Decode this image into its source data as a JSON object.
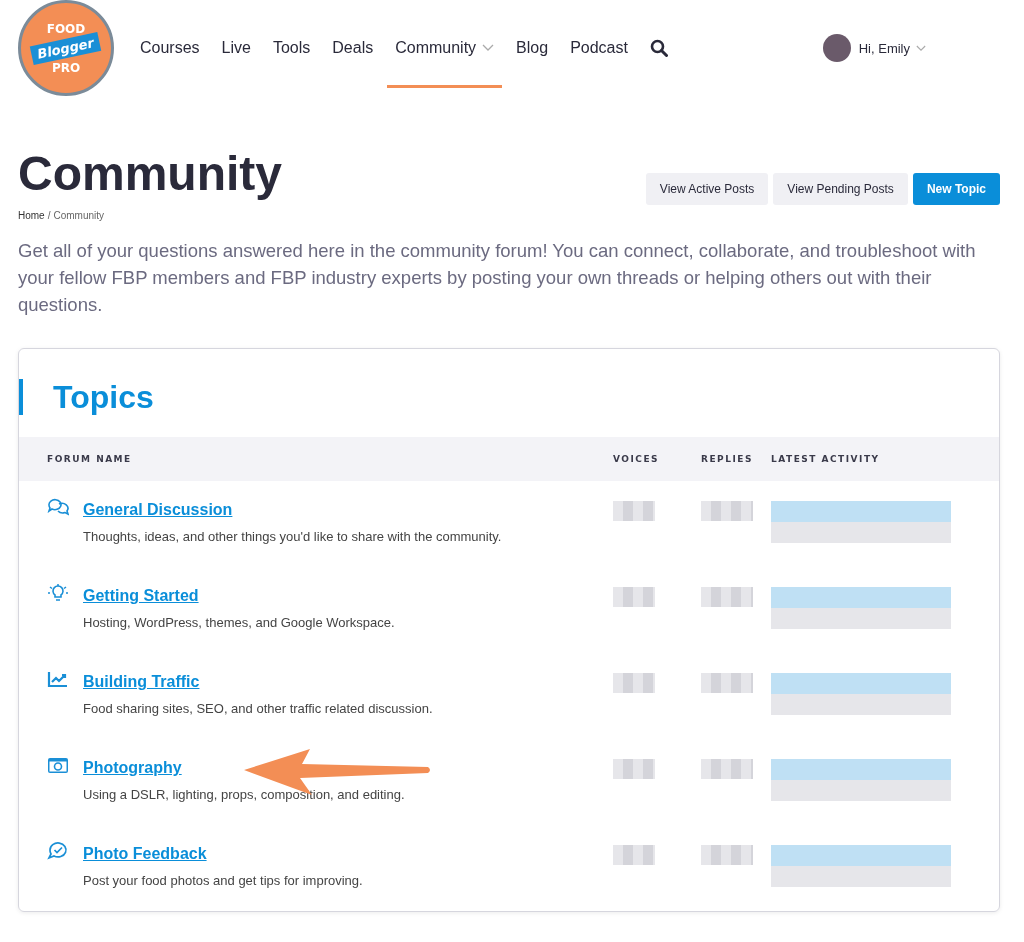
{
  "logo": {
    "top": "FOOD",
    "middle": "Blogger",
    "bottom": "PRO"
  },
  "nav": [
    {
      "label": "Courses",
      "selected": false,
      "has_menu": false
    },
    {
      "label": "Live",
      "selected": false,
      "has_menu": false
    },
    {
      "label": "Tools",
      "selected": false,
      "has_menu": false
    },
    {
      "label": "Deals",
      "selected": false,
      "has_menu": false
    },
    {
      "label": "Community",
      "selected": true,
      "has_menu": true
    },
    {
      "label": "Blog",
      "selected": false,
      "has_menu": false
    },
    {
      "label": "Podcast",
      "selected": false,
      "has_menu": false
    }
  ],
  "user": {
    "greeting": "Hi, Emily"
  },
  "page": {
    "title": "Community",
    "breadcrumb": [
      "Home",
      "Community"
    ],
    "breadcrumb_separator": "/",
    "intro": "Get all of your questions answered here in the community forum! You can connect, collaborate, and troubleshoot with your fellow FBP members and FBP industry experts by posting your own threads or helping others out with their questions."
  },
  "actions": [
    {
      "label": "View Active Posts",
      "kind": "secondary"
    },
    {
      "label": "View Pending Posts",
      "kind": "secondary"
    },
    {
      "label": "New Topic",
      "kind": "primary"
    }
  ],
  "topics": {
    "title": "Topics",
    "columns": [
      "FORUM NAME",
      "VOICES",
      "REPLIES",
      "LATEST ACTIVITY"
    ],
    "rows": [
      {
        "kind": "chat",
        "name": "General Discussion",
        "description": "Thoughts, ideas, and other things you'd like to share with the community.",
        "highlighted": false
      },
      {
        "kind": "bulb",
        "name": "Getting Started",
        "description": "Hosting, WordPress, themes, and Google Workspace.",
        "highlighted": false
      },
      {
        "kind": "chart",
        "name": "Building Traffic",
        "description": "Food sharing sites, SEO, and other traffic related discussion.",
        "highlighted": false
      },
      {
        "kind": "camera",
        "name": "Photography",
        "description": "Using a DSLR, lighting, props, composition, and editing.",
        "highlighted": true
      },
      {
        "kind": "check",
        "name": "Photo Feedback",
        "description": "Post your food photos and get tips for improving.",
        "highlighted": false
      }
    ]
  }
}
